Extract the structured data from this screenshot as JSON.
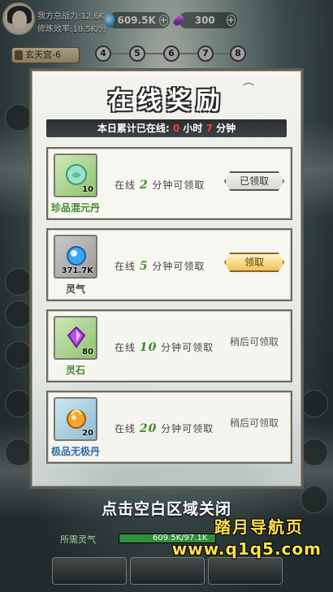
{
  "player": {
    "power": "我方总战力:12.6K",
    "rate": "修炼效率:18.5K/分"
  },
  "resources": [
    {
      "icon": "spirit-orb-icon",
      "value": "609.5K"
    },
    {
      "icon": "purple-crystal-icon",
      "value": "300"
    }
  ],
  "stage": {
    "label": "玄天宫-6",
    "nodes": [
      "4",
      "5",
      "6",
      "7",
      "8"
    ]
  },
  "modal": {
    "title": "在线奖励",
    "online_prefix": "本日累计已在线:",
    "hours": "0",
    "hours_unit": "小时",
    "minutes": "7",
    "minutes_unit": "分钟",
    "rewards": [
      {
        "name": "珍品混元丹",
        "count": "10",
        "cond_prefix": "在线",
        "minutes": "2",
        "cond_suffix": "分钟可领取",
        "button": "已领取",
        "state": "claimed",
        "bg": "green",
        "icon": "jade-pill-icon"
      },
      {
        "name": "灵气",
        "count": "371.7K",
        "cond_prefix": "在线",
        "minutes": "5",
        "cond_suffix": "分钟可领取",
        "button": "领取",
        "state": "claim",
        "bg": "gray",
        "icon": "spirit-orb-icon"
      },
      {
        "name": "灵石",
        "count": "80",
        "cond_prefix": "在线",
        "minutes": "10",
        "cond_suffix": "分钟可领取",
        "button": "稍后可领取",
        "state": "later",
        "bg": "green",
        "icon": "spirit-stone-icon"
      },
      {
        "name": "极品无极丹",
        "count": "20",
        "cond_prefix": "在线",
        "minutes": "20",
        "cond_suffix": "分钟可领取",
        "button": "稍后可领取",
        "state": "later",
        "bg": "blue",
        "icon": "golden-pill-icon"
      }
    ]
  },
  "close_hint": "点击空白区域关闭",
  "required": {
    "label": "所需灵气",
    "value": "609.5K/97.1K",
    "progress": 1.0
  },
  "watermark": {
    "line1": "踏月导航页",
    "line2": "www.q1q5.com"
  },
  "colors": {
    "accent_red": "#ff3a30",
    "watermark": "#ffe14a"
  }
}
